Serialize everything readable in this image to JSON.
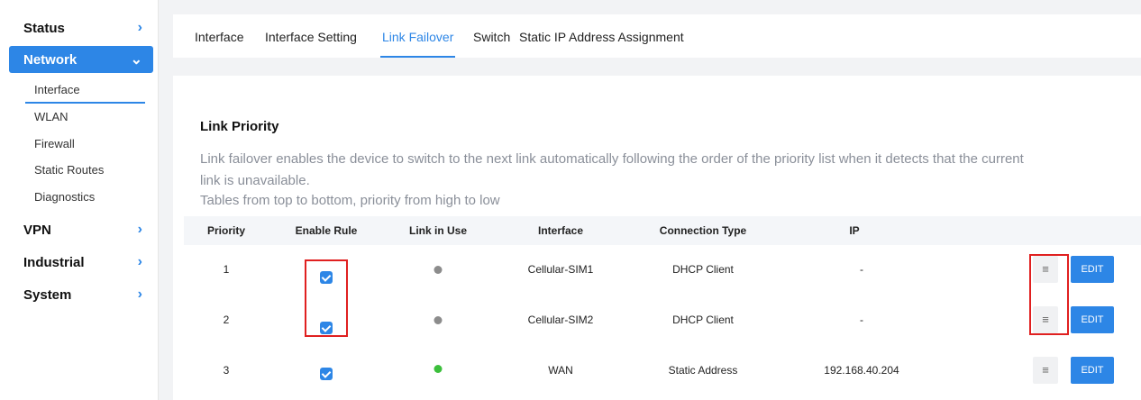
{
  "sidebar": {
    "items": [
      {
        "label": "Status",
        "chevron": "›"
      },
      {
        "label": "Network",
        "chevron": "⌄"
      },
      {
        "label": "VPN",
        "chevron": "›"
      },
      {
        "label": "Industrial",
        "chevron": "›"
      },
      {
        "label": "System",
        "chevron": "›"
      }
    ],
    "network_sub": [
      "Interface",
      "WLAN",
      "Firewall",
      "Static Routes",
      "Diagnostics"
    ]
  },
  "tabs": [
    "Interface",
    "Interface Setting",
    "Link Failover",
    "Switch",
    "Static IP Address Assignment"
  ],
  "active_tab": "Link Failover",
  "section": {
    "title": "Link Priority",
    "desc_line1": "Link failover enables the device to switch to the next link automatically following the order of the priority list when it detects that the current",
    "desc_line2": "link is unavailable.",
    "desc_line3": "Tables from top to bottom, priority from high to low"
  },
  "table": {
    "headers": [
      "Priority",
      "Enable Rule",
      "Link in Use",
      "Interface",
      "Connection Type",
      "IP"
    ],
    "rows": [
      {
        "priority": "1",
        "enabled": true,
        "link_status": "gray",
        "interface": "Cellular-SIM1",
        "connection_type": "DHCP Client",
        "ip": "-",
        "drag": "≡",
        "edit": "EDIT"
      },
      {
        "priority": "2",
        "enabled": true,
        "link_status": "gray",
        "interface": "Cellular-SIM2",
        "connection_type": "DHCP Client",
        "ip": "-",
        "drag": "≡",
        "edit": "EDIT"
      },
      {
        "priority": "3",
        "enabled": true,
        "link_status": "green",
        "interface": "WAN",
        "connection_type": "Static Address",
        "ip": "192.168.40.204",
        "drag": "≡",
        "edit": "EDIT"
      }
    ]
  },
  "colors": {
    "accent": "#2d86e6",
    "status_gray": "#8c8c8c",
    "status_green": "#3cbf3c",
    "highlight": "#e02020"
  }
}
